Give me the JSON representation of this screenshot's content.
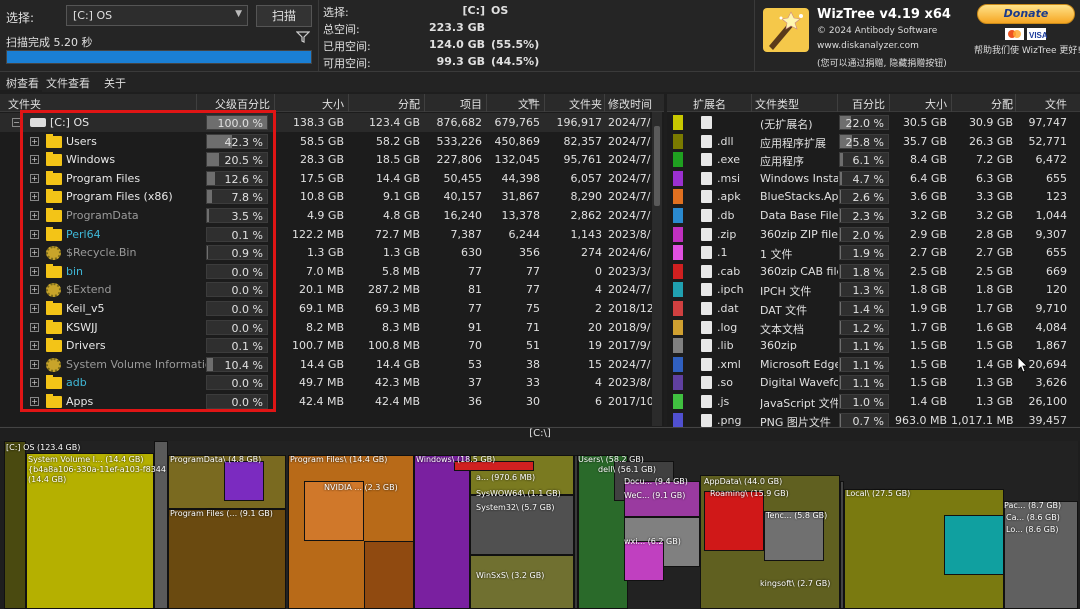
{
  "top": {
    "select_label": "选择:",
    "drive_value": "[C:] OS",
    "scan_button": "扫描",
    "scan_status": "扫描完成 5.20 秒",
    "progress": 1.0
  },
  "info": {
    "rows": [
      {
        "k": "选择:",
        "v": "[C:]",
        "p": "OS"
      },
      {
        "k": "总空间:",
        "v": "223.3 GB",
        "p": ""
      },
      {
        "k": "已用空间:",
        "v": "124.0 GB",
        "p": "(55.5%)"
      },
      {
        "k": "可用空间:",
        "v": "99.3 GB",
        "p": "(44.5%)"
      }
    ]
  },
  "brand": {
    "title": "WizTree v4.19 x64",
    "copyright": "© 2024 Antibody Software",
    "url": "www.diskanalyzer.com",
    "hint": "(您可以通过捐赠, 隐藏捐赠按钮)"
  },
  "donate": {
    "label": "Donate",
    "hint": "帮助我们使 WizTree 更好!"
  },
  "tabs": [
    "树查看",
    "文件查看",
    "关于"
  ],
  "tree": {
    "columns": [
      "文件夹",
      "父级百分比",
      "大小",
      "分配",
      "项目",
      "文件",
      "文件夹",
      "修改时间"
    ],
    "rows": [
      {
        "name": "[C:] OS",
        "pct": "100.0 %",
        "pv": 1.0,
        "size": "138.3 GB",
        "alloc": "123.4 GB",
        "items": "876,682",
        "files": "679,765",
        "folders": "196,917",
        "mod": "2024/7/",
        "icon": "drive",
        "color": "#e8e8e8"
      },
      {
        "name": "Users",
        "pct": "42.3 %",
        "pv": 0.423,
        "size": "58.5 GB",
        "alloc": "58.2 GB",
        "items": "533,226",
        "files": "450,869",
        "folders": "82,357",
        "mod": "2024/7/",
        "icon": "folder",
        "color": "#e8e8e8"
      },
      {
        "name": "Windows",
        "pct": "20.5 %",
        "pv": 0.205,
        "size": "28.3 GB",
        "alloc": "18.5 GB",
        "items": "227,806",
        "files": "132,045",
        "folders": "95,761",
        "mod": "2024/7/",
        "icon": "folder",
        "color": "#e8e8e8"
      },
      {
        "name": "Program Files",
        "pct": "12.6 %",
        "pv": 0.126,
        "size": "17.5 GB",
        "alloc": "14.4 GB",
        "items": "50,455",
        "files": "44,398",
        "folders": "6,057",
        "mod": "2024/7/",
        "icon": "folder",
        "color": "#e8e8e8"
      },
      {
        "name": "Program Files (x86)",
        "pct": "7.8 %",
        "pv": 0.078,
        "size": "10.8 GB",
        "alloc": "9.1 GB",
        "items": "40,157",
        "files": "31,867",
        "folders": "8,290",
        "mod": "2024/7/",
        "icon": "folder",
        "color": "#e8e8e8"
      },
      {
        "name": "ProgramData",
        "pct": "3.5 %",
        "pv": 0.035,
        "size": "4.9 GB",
        "alloc": "4.8 GB",
        "items": "16,240",
        "files": "13,378",
        "folders": "2,862",
        "mod": "2024/7/",
        "icon": "folder",
        "color": "#9a9a9a"
      },
      {
        "name": "Perl64",
        "pct": "0.1 %",
        "pv": 0.001,
        "size": "122.2 MB",
        "alloc": "72.7 MB",
        "items": "7,387",
        "files": "6,244",
        "folders": "1,143",
        "mod": "2023/8/",
        "icon": "folder",
        "color": "#3fb8d8"
      },
      {
        "name": "$Recycle.Bin",
        "pct": "0.9 %",
        "pv": 0.009,
        "size": "1.3 GB",
        "alloc": "1.3 GB",
        "items": "630",
        "files": "356",
        "folders": "274",
        "mod": "2024/6/",
        "icon": "gear",
        "color": "#9a9a9a"
      },
      {
        "name": "bin",
        "pct": "0.0 %",
        "pv": 0.0,
        "size": "7.0 MB",
        "alloc": "5.8 MB",
        "items": "77",
        "files": "77",
        "folders": "0",
        "mod": "2023/3/",
        "icon": "folder",
        "color": "#3fb8d8"
      },
      {
        "name": "$Extend",
        "pct": "0.0 %",
        "pv": 0.0,
        "size": "20.1 MB",
        "alloc": "287.2 MB",
        "items": "81",
        "files": "77",
        "folders": "4",
        "mod": "2024/7/",
        "icon": "gear",
        "color": "#9a9a9a"
      },
      {
        "name": "Keil_v5",
        "pct": "0.0 %",
        "pv": 0.0,
        "size": "69.1 MB",
        "alloc": "69.3 MB",
        "items": "77",
        "files": "75",
        "folders": "2",
        "mod": "2018/12",
        "icon": "folder",
        "color": "#e8e8e8"
      },
      {
        "name": "KSWJJ",
        "pct": "0.0 %",
        "pv": 0.0,
        "size": "8.2 MB",
        "alloc": "8.3 MB",
        "items": "91",
        "files": "71",
        "folders": "20",
        "mod": "2018/9/",
        "icon": "folder",
        "color": "#e8e8e8"
      },
      {
        "name": "Drivers",
        "pct": "0.1 %",
        "pv": 0.001,
        "size": "100.7 MB",
        "alloc": "100.8 MB",
        "items": "70",
        "files": "51",
        "folders": "19",
        "mod": "2017/9/",
        "icon": "folder",
        "color": "#e8e8e8"
      },
      {
        "name": "System Volume Information",
        "pct": "10.4 %",
        "pv": 0.104,
        "size": "14.4 GB",
        "alloc": "14.4 GB",
        "items": "53",
        "files": "38",
        "folders": "15",
        "mod": "2024/7/",
        "icon": "gear",
        "color": "#9a9a9a"
      },
      {
        "name": "adb",
        "pct": "0.0 %",
        "pv": 0.0,
        "size": "49.7 MB",
        "alloc": "42.3 MB",
        "items": "37",
        "files": "33",
        "folders": "4",
        "mod": "2023/8/",
        "icon": "folder",
        "color": "#3fb8d8"
      },
      {
        "name": "Apps",
        "pct": "0.0 %",
        "pv": 0.0,
        "size": "42.4 MB",
        "alloc": "42.4 MB",
        "items": "36",
        "files": "30",
        "folders": "6",
        "mod": "2017/10",
        "icon": "folder",
        "color": "#e8e8e8"
      }
    ]
  },
  "types": {
    "columns": [
      "扩展名",
      "文件类型",
      "百分比",
      "大小",
      "分配",
      "文件"
    ],
    "rows": [
      {
        "ext": "",
        "type": "(无扩展名)",
        "pct": "22.0 %",
        "pv": 0.22,
        "size": "30.5 GB",
        "alloc": "30.9 GB",
        "files": "97,747",
        "color": "#c8c800"
      },
      {
        "ext": ".dll",
        "type": "应用程序扩展",
        "pct": "25.8 %",
        "pv": 0.258,
        "size": "35.7 GB",
        "alloc": "26.3 GB",
        "files": "52,771",
        "color": "#7a7a00"
      },
      {
        "ext": ".exe",
        "type": "应用程序",
        "pct": "6.1 %",
        "pv": 0.061,
        "size": "8.4 GB",
        "alloc": "7.2 GB",
        "files": "6,472",
        "color": "#1fa020"
      },
      {
        "ext": ".msi",
        "type": "Windows Installe",
        "pct": "4.7 %",
        "pv": 0.047,
        "size": "6.4 GB",
        "alloc": "6.3 GB",
        "files": "655",
        "color": "#9b30d0"
      },
      {
        "ext": ".apk",
        "type": "BlueStacks.Apk",
        "pct": "2.6 %",
        "pv": 0.026,
        "size": "3.6 GB",
        "alloc": "3.3 GB",
        "files": "123",
        "color": "#e07020"
      },
      {
        "ext": ".db",
        "type": "Data Base File",
        "pct": "2.3 %",
        "pv": 0.023,
        "size": "3.2 GB",
        "alloc": "3.2 GB",
        "files": "1,044",
        "color": "#2a8ad0"
      },
      {
        "ext": ".zip",
        "type": "360zip ZIP file",
        "pct": "2.0 %",
        "pv": 0.02,
        "size": "2.9 GB",
        "alloc": "2.8 GB",
        "files": "9,307",
        "color": "#c030c0"
      },
      {
        "ext": ".1",
        "type": "1 文件",
        "pct": "1.9 %",
        "pv": 0.019,
        "size": "2.7 GB",
        "alloc": "2.7 GB",
        "files": "655",
        "color": "#e050e0"
      },
      {
        "ext": ".cab",
        "type": "360zip CAB file",
        "pct": "1.8 %",
        "pv": 0.018,
        "size": "2.5 GB",
        "alloc": "2.5 GB",
        "files": "669",
        "color": "#d02020"
      },
      {
        "ext": ".ipch",
        "type": "IPCH 文件",
        "pct": "1.3 %",
        "pv": 0.013,
        "size": "1.8 GB",
        "alloc": "1.8 GB",
        "files": "120",
        "color": "#20a0b0"
      },
      {
        "ext": ".dat",
        "type": "DAT 文件",
        "pct": "1.4 %",
        "pv": 0.014,
        "size": "1.9 GB",
        "alloc": "1.7 GB",
        "files": "9,710",
        "color": "#d04040"
      },
      {
        "ext": ".log",
        "type": "文本文档",
        "pct": "1.2 %",
        "pv": 0.012,
        "size": "1.7 GB",
        "alloc": "1.6 GB",
        "files": "4,084",
        "color": "#d0a030"
      },
      {
        "ext": ".lib",
        "type": "360zip",
        "pct": "1.1 %",
        "pv": 0.011,
        "size": "1.5 GB",
        "alloc": "1.5 GB",
        "files": "1,867",
        "color": "#808080"
      },
      {
        "ext": ".xml",
        "type": "Microsoft Edge I",
        "pct": "1.1 %",
        "pv": 0.011,
        "size": "1.5 GB",
        "alloc": "1.4 GB",
        "files": "20,694",
        "color": "#3060c0"
      },
      {
        "ext": ".so",
        "type": "Digital Wavefor",
        "pct": "1.1 %",
        "pv": 0.011,
        "size": "1.5 GB",
        "alloc": "1.3 GB",
        "files": "3,626",
        "color": "#6040a0"
      },
      {
        "ext": ".js",
        "type": "JavaScript 文件",
        "pct": "1.0 %",
        "pv": 0.01,
        "size": "1.4 GB",
        "alloc": "1.3 GB",
        "files": "26,100",
        "color": "#40c040"
      },
      {
        "ext": ".png",
        "type": "PNG 图片文件",
        "pct": "0.7 %",
        "pv": 0.007,
        "size": "963.0 MB",
        "alloc": "1,017.1 MB",
        "files": "39,457",
        "color": "#5050d0"
      }
    ]
  },
  "treemap": {
    "path": "[C:\\]",
    "labels": [
      "[C:] OS  (123.4 GB)",
      "System Volume I... (14.4 GB)",
      "{b4a8a106-330a-11ef-a103-f8344",
      "(14.4 GB)",
      "ProgramData\\ (4.8 GB)",
      "Program Files\\ (14.4 GB)",
      "NVIDIA ... (2.3 GB)",
      "Program Files (... (9.1 GB)",
      "Windows\\ (18.5 GB)",
      "a... (970.6 MB)",
      "SysWOW64\\ (1.1 GB)",
      "System32\\ (5.7 GB)",
      "WinSxS\\ (3.2 GB)",
      "Users\\ (58.2 GB)",
      "dell\\ (56.1 GB)",
      "Docu... (9.4 GB)",
      "WeC... (9.1 GB)",
      "wxi... (6.2 GB)",
      "AppData\\ (44.0 GB)",
      "Roaming\\ (15.9 GB)",
      "Tenc... (5.8 GB)",
      "kingsoft\\ (2.7 GB)",
      "Local\\ (27.5 GB)",
      "Pac... (8.7 GB)",
      "Ca... (8.6 GB)",
      "Lo... (8.6 GB)"
    ]
  }
}
